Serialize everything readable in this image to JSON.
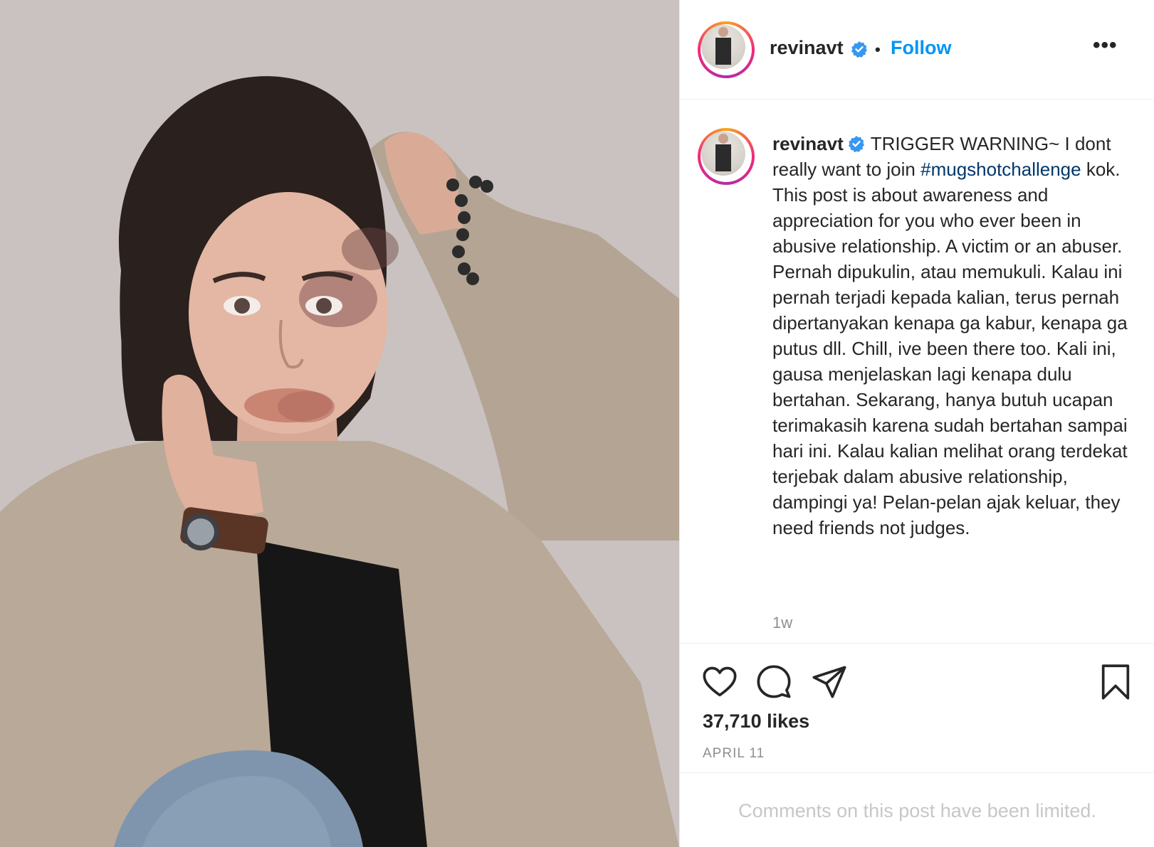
{
  "post": {
    "username": "revinavt",
    "follow_label": "Follow",
    "more_label": "•••",
    "separator": "•",
    "caption": {
      "username": "revinavt",
      "before_hashtag": "TRIGGER WARNING~ I dont really want to join ",
      "hashtag": "#mugshotchallenge",
      "after_hashtag": " kok. This post is about awareness and appreciation for you who ever been in abusive relationship. A victim or an abuser. Pernah dipukulin, atau memukuli. Kalau ini pernah terjadi kepada kalian, terus pernah dipertanyakan kenapa ga kabur, kenapa ga putus dll. Chill, ive been there too. Kali ini, gausa menjelaskan lagi kenapa dulu bertahan. Sekarang, hanya butuh ucapan terimakasih karena sudah bertahan sampai hari ini. Kalau kalian melihat orang terdekat terjebak dalam abusive relationship, dampingi ya! Pelan-pelan ajak keluar, they need friends not judges."
    },
    "time_ago": "1w",
    "likes": "37,710 likes",
    "date": "APRIL 11",
    "comments_notice": "Comments on this post have been limited."
  },
  "icons": {
    "verified": "verified-badge-icon",
    "like": "heart-icon",
    "comment": "comment-bubble-icon",
    "share": "paper-plane-icon",
    "save": "bookmark-icon",
    "more": "more-options-icon"
  },
  "colors": {
    "follow": "#0095f6",
    "hashtag": "#00376b",
    "verified": "#3897f0",
    "muted": "#8e8e8e",
    "limited": "#c7c7c7",
    "text": "#262626"
  }
}
